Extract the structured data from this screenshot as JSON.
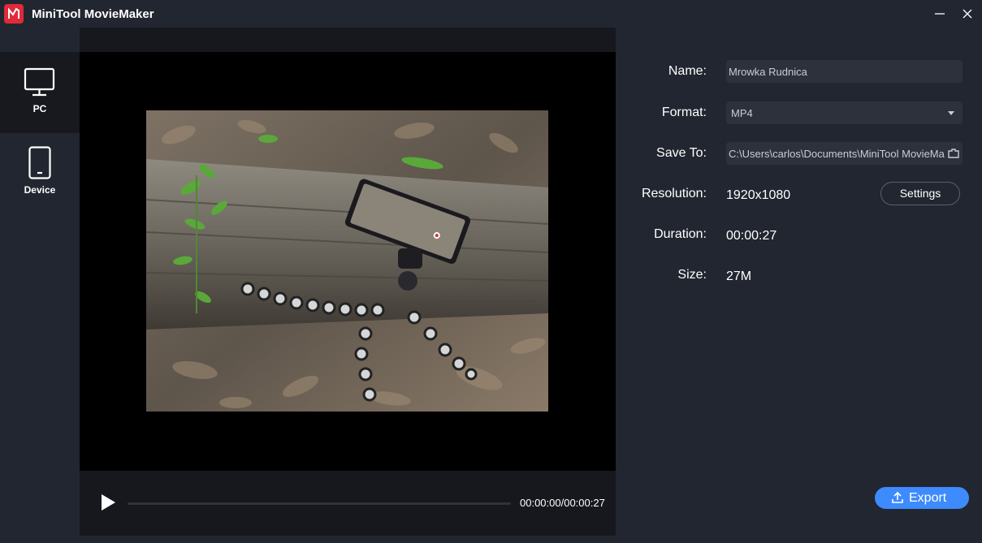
{
  "app": {
    "title": "MiniTool MovieMaker"
  },
  "sidebar": {
    "items": [
      {
        "label": "PC",
        "icon": "monitor-icon",
        "active": true
      },
      {
        "label": "Device",
        "icon": "phone-icon",
        "active": false
      }
    ]
  },
  "player": {
    "time": "00:00:00/00:00:27",
    "progress": 0
  },
  "export": {
    "name_label": "Name:",
    "name_value": "Mrowka Rudnica",
    "format_label": "Format:",
    "format_value": "MP4",
    "save_label": "Save To:",
    "save_value": "C:\\Users\\carlos\\Documents\\MiniTool MovieMa",
    "resolution_label": "Resolution:",
    "resolution_value": "1920x1080",
    "settings_label": "Settings",
    "duration_label": "Duration:",
    "duration_value": "00:00:27",
    "size_label": "Size:",
    "size_value": "27M",
    "export_label": "Export"
  },
  "colors": {
    "accent": "#3d8bfd",
    "background": "#222630",
    "logo": "#e02a3a"
  }
}
